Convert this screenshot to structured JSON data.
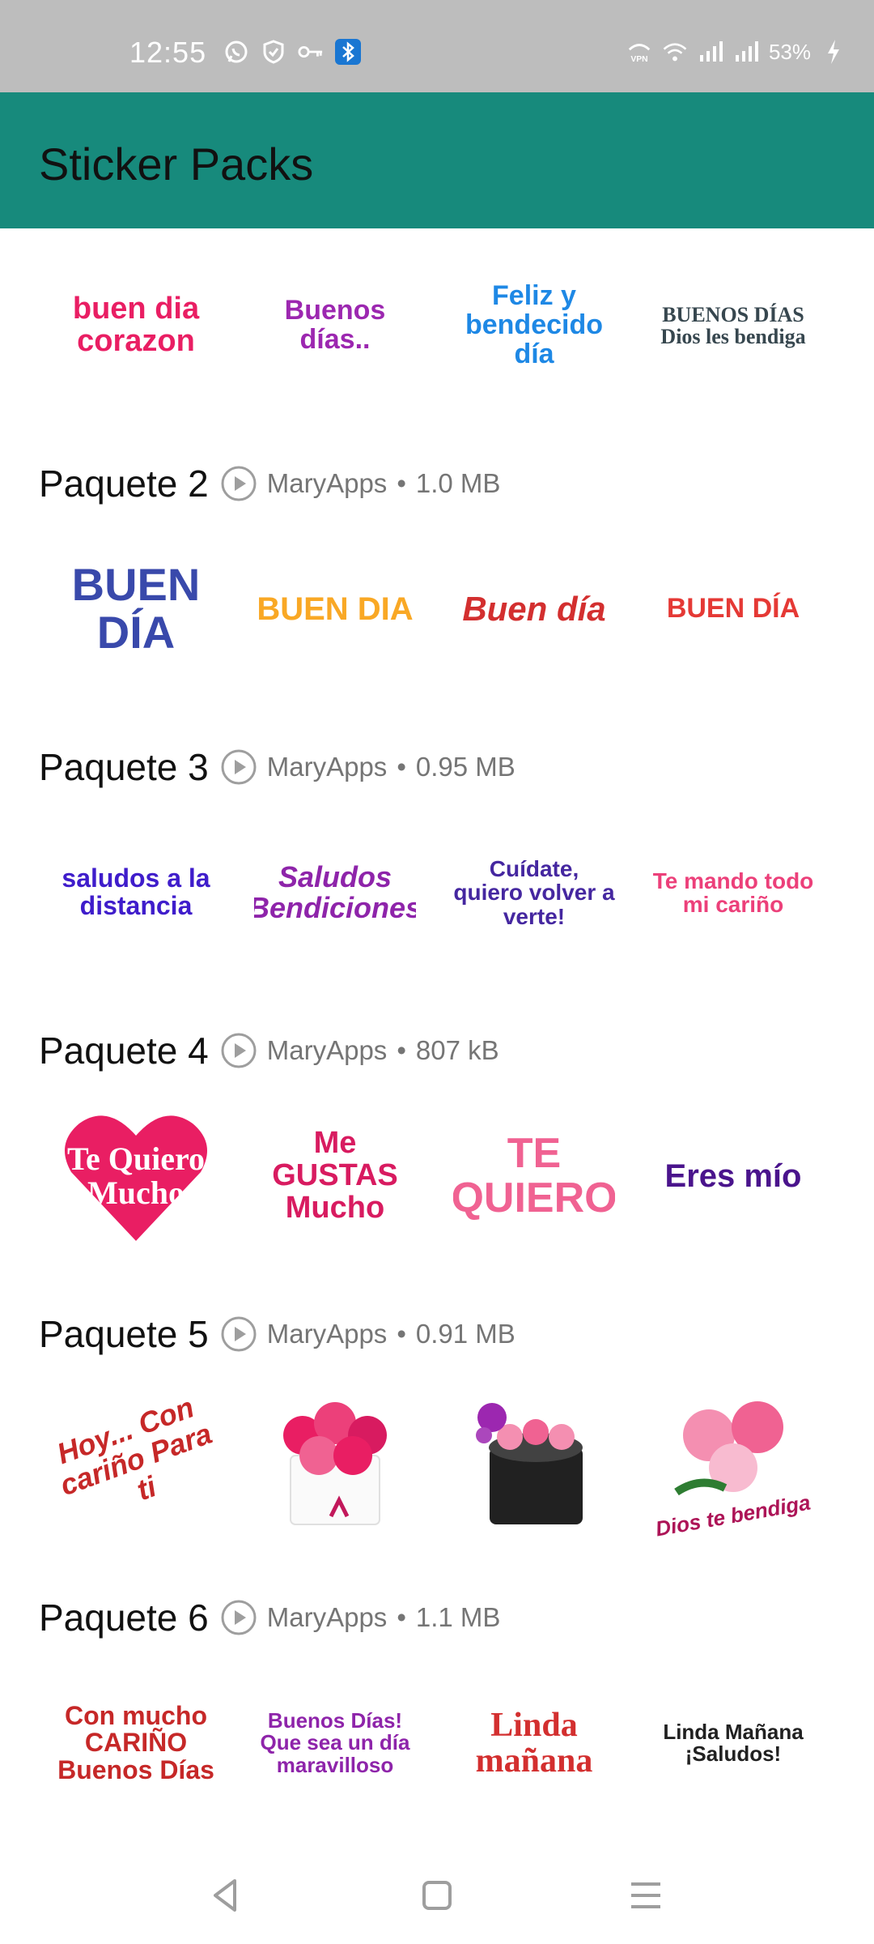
{
  "status_bar": {
    "time": "12:55",
    "battery": "53%",
    "icons_left": [
      "whatsapp-icon",
      "shield-icon",
      "key-icon",
      "bluetooth-icon"
    ],
    "icons_right": [
      "vpn-icon",
      "wifi-icon",
      "signal-icon",
      "signal-icon",
      "battery-charging-icon"
    ]
  },
  "app_bar": {
    "title": "Sticker Packs"
  },
  "packs": [
    {
      "stickers": [
        {
          "text": "buen dia corazon",
          "color": "#e91e63"
        },
        {
          "text": "Buenos días..",
          "color": "#9c27b0"
        },
        {
          "text": "Feliz y bendecido día",
          "color": "#1e88e5"
        },
        {
          "text": "BUENOS DÍAS Dios les bendiga",
          "color": "#37474f"
        }
      ]
    },
    {
      "name": "Paquete 2",
      "author": "MaryApps",
      "size": "1.0 MB",
      "stickers": [
        {
          "text": "BUEN DÍA",
          "color": "#3949ab"
        },
        {
          "text": "BUEN DIA",
          "color": "#f9a825"
        },
        {
          "text": "Buen día",
          "color": "#d32f2f"
        },
        {
          "text": "BUEN DÍA",
          "color": "#e53935"
        }
      ]
    },
    {
      "name": "Paquete 3",
      "author": "MaryApps",
      "size": "0.95 MB",
      "stickers": [
        {
          "text": "saludos a la distancia",
          "color": "#3f1dcb"
        },
        {
          "text": "Saludos Bendiciones",
          "color": "#8e24aa"
        },
        {
          "text": "Cuídate, quiero volver a verte!",
          "color": "#4527a0"
        },
        {
          "text": "Te mando todo mi cariño",
          "color": "#ec407a"
        }
      ]
    },
    {
      "name": "Paquete 4",
      "author": "MaryApps",
      "size": "807 kB",
      "stickers": [
        {
          "text": "Te Quiero Mucho",
          "color": "#e91e63"
        },
        {
          "text": "Me GUSTAS Mucho",
          "color": "#d81b60"
        },
        {
          "text": "TE QUIERO",
          "color": "#f06292"
        },
        {
          "text": "Eres mío",
          "color": "#4a148c"
        }
      ]
    },
    {
      "name": "Paquete 5",
      "author": "MaryApps",
      "size": "0.91 MB",
      "stickers": [
        {
          "text": "Hoy... Con cariño Para ti",
          "color": "#c62828"
        },
        {
          "text": "",
          "color": "#e91e63"
        },
        {
          "text": "",
          "color": "#212121"
        },
        {
          "text": "Dios te bendiga",
          "color": "#ad1457"
        }
      ]
    },
    {
      "name": "Paquete 6",
      "author": "MaryApps",
      "size": "1.1 MB",
      "stickers": [
        {
          "text": "Con mucho CARIÑO Buenos Días",
          "color": "#c62828"
        },
        {
          "text": "Buenos Días! Que sea un día maravilloso",
          "color": "#8e24aa"
        },
        {
          "text": "Linda mañana",
          "color": "#d32f2f"
        },
        {
          "text": "Linda Mañana ¡Saludos!",
          "color": "#212121"
        }
      ]
    }
  ],
  "nav_bar": {
    "buttons": [
      "back-icon",
      "home-icon",
      "recents-icon"
    ]
  }
}
